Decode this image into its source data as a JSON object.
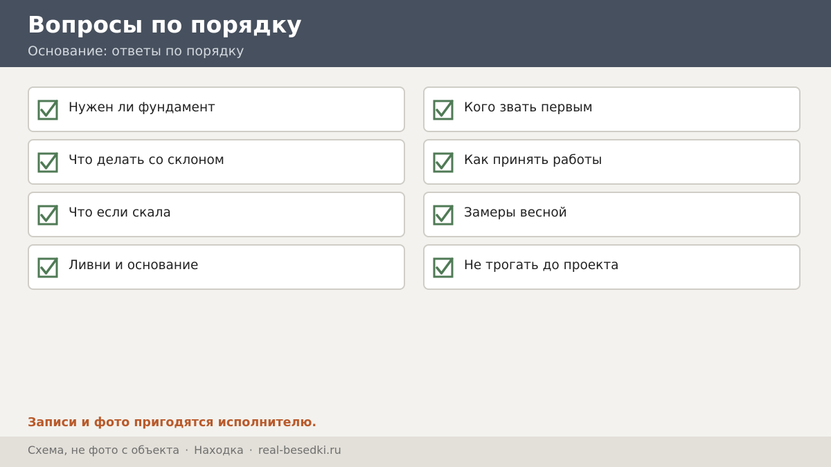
{
  "header": {
    "title": "Вопросы по порядку",
    "subtitle": "Основание: ответы по порядку"
  },
  "items": [
    {
      "label": "Нужен ли фундамент",
      "checked": true
    },
    {
      "label": "Кого звать первым",
      "checked": true
    },
    {
      "label": "Что делать со склоном",
      "checked": true
    },
    {
      "label": "Как принять работы",
      "checked": true
    },
    {
      "label": "Что если скала",
      "checked": true
    },
    {
      "label": "Замеры весной",
      "checked": true
    },
    {
      "label": "Ливни и основание",
      "checked": true
    },
    {
      "label": "Не трогать до проекта",
      "checked": true
    }
  ],
  "note": "Записи и фото пригодятся исполнителю.",
  "footer": {
    "parts": [
      "Схема, не фото с объекта",
      "Находка",
      "real-besedki.ru"
    ],
    "separator": "·"
  },
  "colors": {
    "header_bg": "#47505e",
    "check": "#4f7a55",
    "note": "#b95a2b"
  }
}
